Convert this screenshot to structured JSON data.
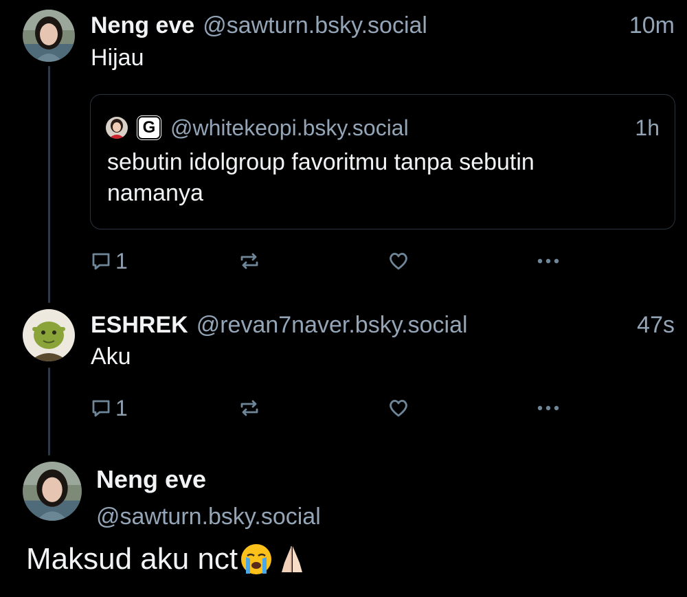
{
  "posts": [
    {
      "display_name": "Neng eve",
      "handle": "@sawturn.bsky.social",
      "timestamp": "10m",
      "text": "Hijau",
      "quote": {
        "badge_letter": "G",
        "handle": "@whitekeopi.bsky.social",
        "timestamp": "1h",
        "text": "sebutin idolgroup favoritmu tanpa sebutin namanya"
      },
      "reply_count": "1"
    },
    {
      "display_name": "ESHREK",
      "handle": "@revan7naver.bsky.social",
      "timestamp": "47s",
      "text": "Aku",
      "reply_count": "1"
    }
  ],
  "main_post": {
    "display_name": "Neng eve",
    "handle": "@sawturn.bsky.social",
    "text": "Maksud aku nct"
  },
  "icons": {
    "reply": "speech-bubble-icon",
    "repost": "repost-arrows-icon",
    "like": "heart-outline-icon",
    "more": "ellipsis-icon",
    "emoji_1": "loudly-crying-face-emoji",
    "emoji_2": "folded-hands-emoji"
  },
  "colors": {
    "background": "#000000",
    "text": "#f1f3f5",
    "muted": "#93a5b7",
    "icon": "#6f8699",
    "thread_line": "#2e3a47",
    "card_border": "#2a3340"
  }
}
